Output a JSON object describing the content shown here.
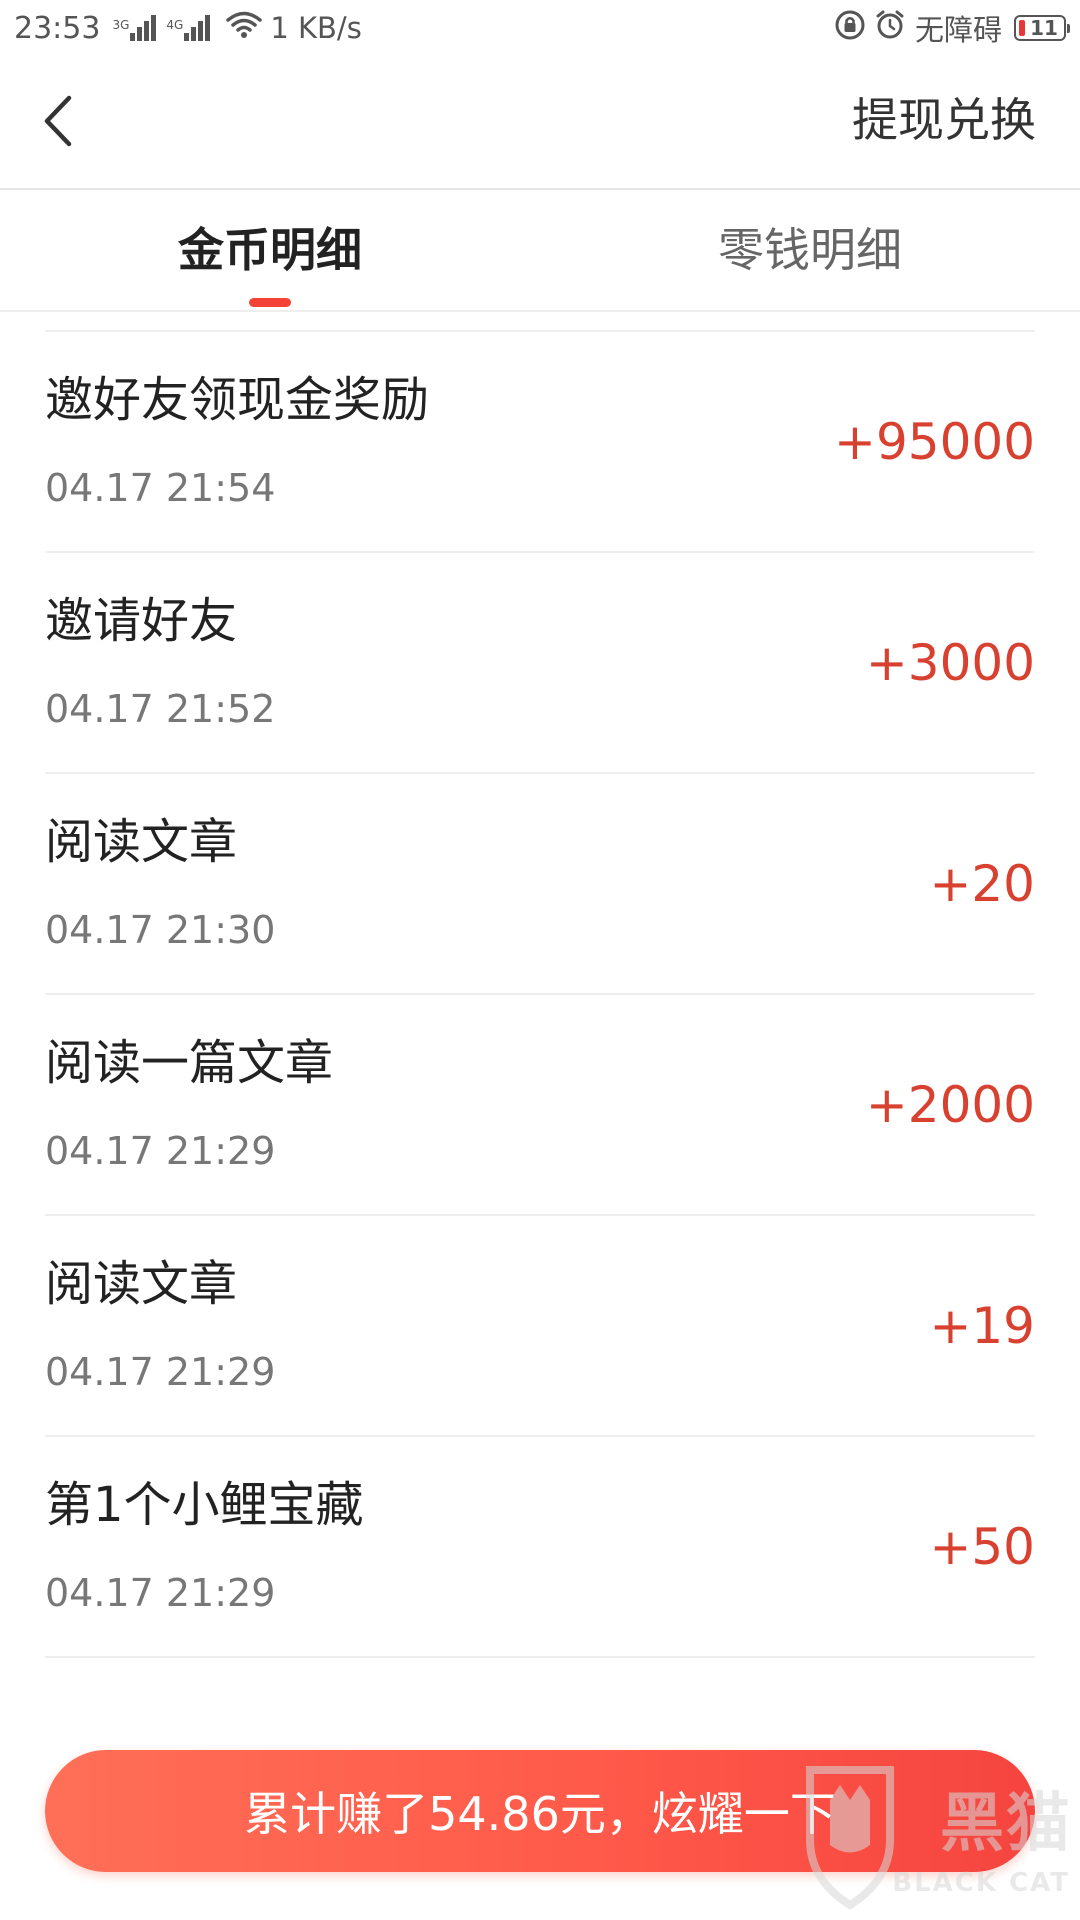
{
  "status_bar": {
    "time": "23:53",
    "net_tag_1": "3G",
    "net_tag_2": "4G",
    "speed": "1 KB/s",
    "accessibility": "无障碍",
    "battery": "11"
  },
  "nav": {
    "back_icon": "chevron-left-icon",
    "action_label": "提现兑换"
  },
  "tabs": [
    {
      "label": "金币明细",
      "active": true
    },
    {
      "label": "零钱明细",
      "active": false
    }
  ],
  "records": [
    {
      "title": "邀好友领现金奖励",
      "time": "04.17 21:54",
      "amount": "+95000"
    },
    {
      "title": "邀请好友",
      "time": "04.17 21:52",
      "amount": "+3000"
    },
    {
      "title": "阅读文章",
      "time": "04.17 21:30",
      "amount": "+20"
    },
    {
      "title": "阅读一篇文章",
      "time": "04.17 21:29",
      "amount": "+2000"
    },
    {
      "title": "阅读文章",
      "time": "04.17 21:29",
      "amount": "+19"
    },
    {
      "title": "第1个小鲤宝藏",
      "time": "04.17 21:29",
      "amount": "+50"
    }
  ],
  "share_button": {
    "label": "累计赚了54.86元，炫耀一下"
  },
  "watermark": {
    "name": "黑猫",
    "sub": "BLACK CAT"
  },
  "colors": {
    "amount": "#d8412f",
    "accent": "#f44336",
    "button_start": "#ff6f57",
    "button_end": "#f5443f"
  }
}
